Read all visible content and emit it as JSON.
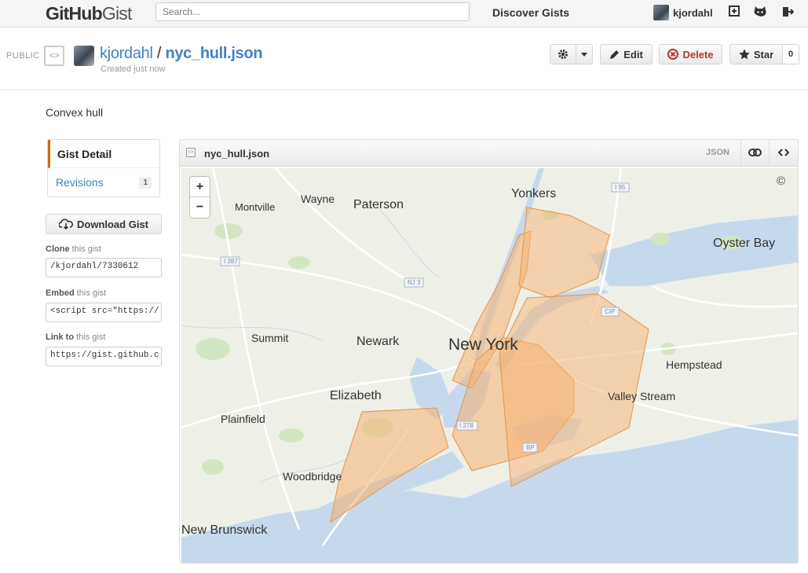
{
  "topbar": {
    "logo_main": "GitHub",
    "logo_sub": "Gist",
    "search_placeholder": "Search...",
    "discover": "Discover Gists",
    "username": "kjordahl"
  },
  "gist": {
    "visibility": "PUBLIC",
    "owner": "kjordahl",
    "separator": "/",
    "filename": "nyc_hull.json",
    "created": "Created just now",
    "description": "Convex hull"
  },
  "actions": {
    "edit": "Edit",
    "delete": "Delete",
    "star": "Star",
    "star_count": "0"
  },
  "sidebar": {
    "nav": [
      {
        "label": "Gist Detail"
      },
      {
        "label": "Revisions",
        "count": "1"
      }
    ],
    "download": "Download Gist",
    "clone_strong": "Clone",
    "clone_rest": " this gist",
    "clone_value": "/kjordahl/7330612",
    "embed_strong": "Embed",
    "embed_rest": " this gist",
    "embed_value": "<script src=\"https://",
    "link_strong": "Link to",
    "link_rest": " this gist",
    "link_value": "https://gist.github.c"
  },
  "file": {
    "name": "nyc_hull.json",
    "type": "JSON"
  },
  "map": {
    "zoom_in": "+",
    "zoom_out": "−",
    "attribution": "©",
    "labels": {
      "yonkers": "Yonkers",
      "wayne": "Wayne",
      "paterson": "Paterson",
      "montville": "Montville",
      "oyster_bay": "Oyster Bay",
      "summit": "Summit",
      "newark": "Newark",
      "new_york": "New York",
      "hempstead": "Hempstead",
      "elizabeth": "Elizabeth",
      "valley_stream": "Valley Stream",
      "plainfield": "Plainfield",
      "woodbridge": "Woodbridge",
      "new_brunswick": "New Brunswick"
    },
    "shields": {
      "i287": "I 287",
      "nj3": "NJ 3",
      "i95": "I 95",
      "cip": "CIP",
      "i278": "I 278",
      "bp": "BP"
    },
    "colors": {
      "water": "#c6d9ec",
      "land": "#eef0e8",
      "hull_fill": "#f5b16f",
      "hull_stroke": "#e0954a"
    }
  }
}
